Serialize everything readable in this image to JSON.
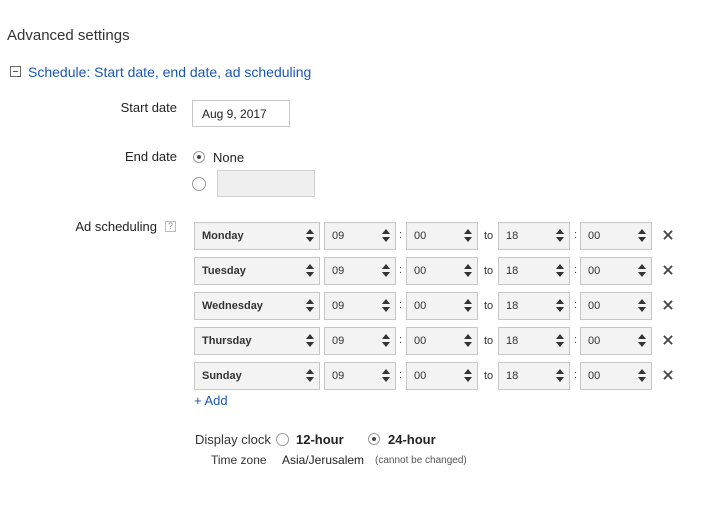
{
  "section": {
    "title": "Advanced settings"
  },
  "schedule": {
    "link_label": "Schedule: Start date, end date, ad scheduling"
  },
  "start_date": {
    "label": "Start date",
    "value": "Aug 9, 2017"
  },
  "end_date": {
    "label": "End date",
    "none_label": "None",
    "selected": "none"
  },
  "ad_scheduling": {
    "label": "Ad scheduling",
    "help": "?",
    "to_label": "to",
    "colon": ":",
    "rows": [
      {
        "day": "Monday",
        "from_hour": "09",
        "from_min": "00",
        "to_hour": "18",
        "to_min": "00"
      },
      {
        "day": "Tuesday",
        "from_hour": "09",
        "from_min": "00",
        "to_hour": "18",
        "to_min": "00"
      },
      {
        "day": "Wednesday",
        "from_hour": "09",
        "from_min": "00",
        "to_hour": "18",
        "to_min": "00"
      },
      {
        "day": "Thursday",
        "from_hour": "09",
        "from_min": "00",
        "to_hour": "18",
        "to_min": "00"
      },
      {
        "day": "Sunday",
        "from_hour": "09",
        "from_min": "00",
        "to_hour": "18",
        "to_min": "00"
      }
    ],
    "add_label": "+ Add"
  },
  "display_clock": {
    "label": "Display clock",
    "option_12": "12-hour",
    "option_24": "24-hour",
    "selected": "24-hour"
  },
  "time_zone": {
    "label": "Time zone",
    "value": "Asia/Jerusalem",
    "note": "(cannot be changed)"
  },
  "colors": {
    "link": "#1a57b5",
    "text": "#222222"
  },
  "icons": {
    "collapse": "minus-square-icon",
    "remove": "close-icon",
    "help": "help-icon"
  }
}
